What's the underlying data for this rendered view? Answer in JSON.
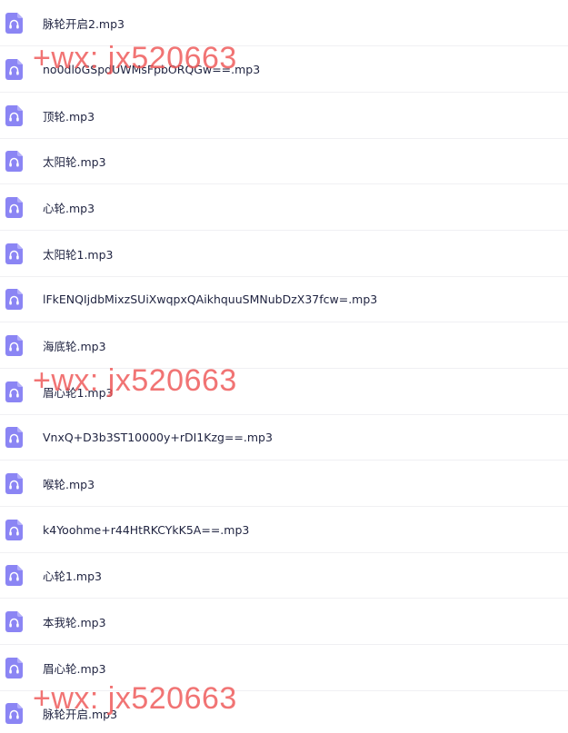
{
  "files": [
    {
      "name": "脉轮开启2.mp3",
      "icon": "audio-file-icon"
    },
    {
      "name": "no0dloGSpdUWMsFpbORQGw==.mp3",
      "icon": "audio-file-icon"
    },
    {
      "name": "顶轮.mp3",
      "icon": "audio-file-icon"
    },
    {
      "name": "太阳轮.mp3",
      "icon": "audio-file-icon"
    },
    {
      "name": "心轮.mp3",
      "icon": "audio-file-icon"
    },
    {
      "name": "太阳轮1.mp3",
      "icon": "audio-file-icon"
    },
    {
      "name": "lFkENQIjdbMixzSUiXwqpxQAikhquuSMNubDzX37fcw=.mp3",
      "icon": "audio-file-icon"
    },
    {
      "name": "海底轮.mp3",
      "icon": "audio-file-icon"
    },
    {
      "name": "眉心轮1.mp3",
      "icon": "audio-file-icon"
    },
    {
      "name": "VnxQ+D3b3ST10000y+rDI1Kzg==.mp3",
      "icon": "audio-file-icon"
    },
    {
      "name": "喉轮.mp3",
      "icon": "audio-file-icon"
    },
    {
      "name": "k4Yoohme+r44HtRKCYkK5A==.mp3",
      "icon": "audio-file-icon"
    },
    {
      "name": "心轮1.mp3",
      "icon": "audio-file-icon"
    },
    {
      "name": "本我轮.mp3",
      "icon": "audio-file-icon"
    },
    {
      "name": "眉心轮.mp3",
      "icon": "audio-file-icon"
    },
    {
      "name": "脉轮开启.mp3",
      "icon": "audio-file-icon"
    }
  ],
  "watermark": {
    "text": "+wx: jx520663"
  },
  "colors": {
    "icon_fill": "#8b85f4",
    "icon_symbol": "#ffffff",
    "watermark": "#ee5656",
    "text": "#1f2340",
    "divider": "#f0f0f3"
  }
}
